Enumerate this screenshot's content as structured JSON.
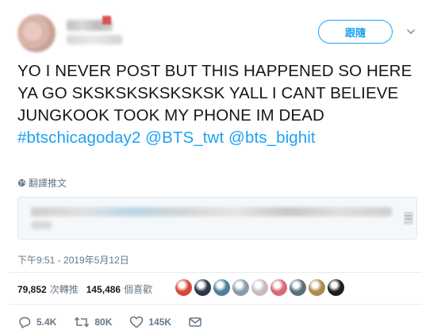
{
  "header": {
    "follow_label": "跟隨"
  },
  "tweet": {
    "text_plain": "YO I NEVER POST BUT THIS HAPPENED SO HERE YA GO SKSKSKSKSKSKSK YALL I CANT BELIEVE JUNGKOOK TOOK MY PHONE IM DEAD ",
    "hashtag": "#btschicagoday2",
    "mention1": "@BTS_twt",
    "mention2": "@bts_bighit",
    "translate_label": "翻譯推文",
    "timestamp": "下午9:51 - 2019年5月12日"
  },
  "stats": {
    "retweets_count": "79,852",
    "retweets_label": "次轉推",
    "likes_count": "145,486",
    "likes_label": "個喜歡"
  },
  "liker_avatars": [
    {
      "icon": "liker-avatar",
      "color": "#d44a3a"
    },
    {
      "icon": "liker-avatar",
      "color": "#2a3a4a"
    },
    {
      "icon": "liker-avatar",
      "color": "#4d7f9a"
    },
    {
      "icon": "liker-avatar",
      "color": "#8a9aa8"
    },
    {
      "icon": "liker-avatar",
      "color": "#c9b9c4"
    },
    {
      "icon": "liker-avatar",
      "color": "#d86a78"
    },
    {
      "icon": "liker-avatar",
      "color": "#5a6f7d"
    },
    {
      "icon": "liker-avatar",
      "color": "#b08a4a"
    },
    {
      "icon": "liker-avatar",
      "color": "#1e1e1e"
    }
  ],
  "actions": {
    "replies": "5.4K",
    "retweets": "80K",
    "likes": "145K"
  },
  "colors": {
    "accent": "#1da1f2",
    "text": "#14171a",
    "muted": "#657786",
    "border": "#e1e8ed"
  }
}
